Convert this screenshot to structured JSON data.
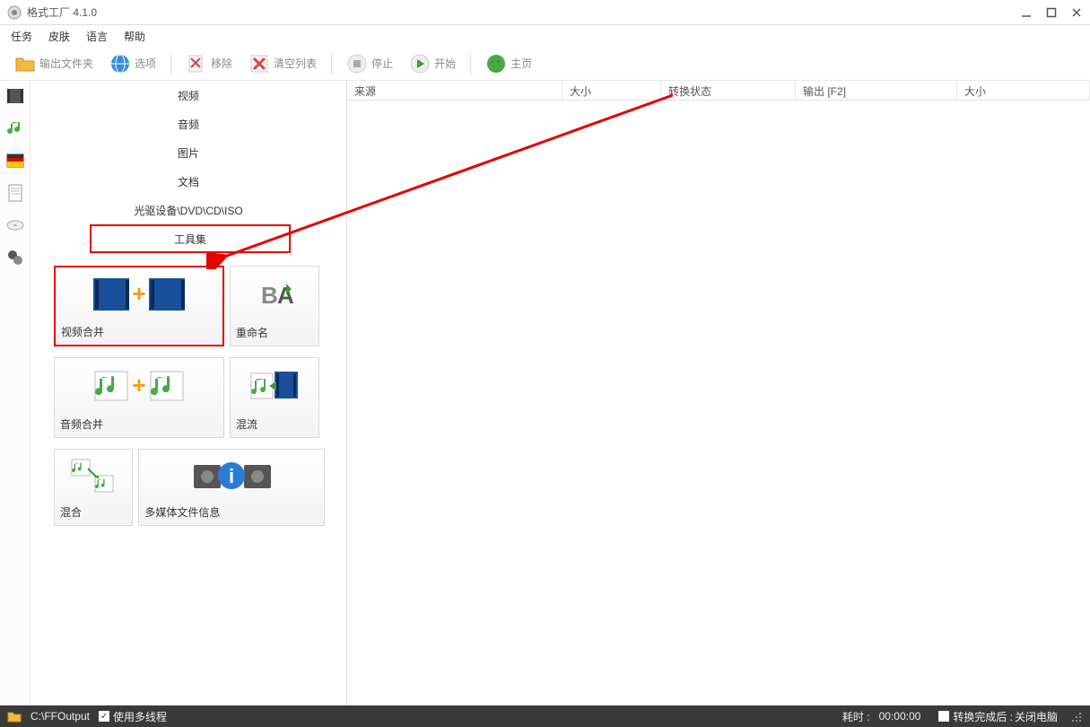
{
  "app": {
    "title": "格式工厂 4.1.0"
  },
  "menu": {
    "task": "任务",
    "skin": "皮肤",
    "language": "语言",
    "help": "帮助"
  },
  "toolbar": {
    "output_folder": "输出文件夹",
    "options": "选项",
    "remove": "移除",
    "clear": "清空列表",
    "stop": "停止",
    "start": "开始",
    "home": "主页"
  },
  "categories": {
    "video": "视频",
    "audio": "音频",
    "image": "图片",
    "doc": "文档",
    "drive": "光驱设备\\DVD\\CD\\ISO",
    "tools": "工具集"
  },
  "tools": {
    "video_join": "视频合并",
    "rename": "重命名",
    "audio_join": "音频合并",
    "mux": "混流",
    "mix": "混合",
    "media_info": "多媒体文件信息"
  },
  "table": {
    "source": "来源",
    "size": "大小",
    "status": "转换状态",
    "output": "输出 [F2]",
    "size2": "大小"
  },
  "status": {
    "folder": "C:\\FFOutput",
    "multithread": "使用多线程",
    "elapsed_label": "耗时 :",
    "elapsed_value": "00:00:00",
    "after_label": "转换完成后 :",
    "after_value": "关闭电脑"
  }
}
